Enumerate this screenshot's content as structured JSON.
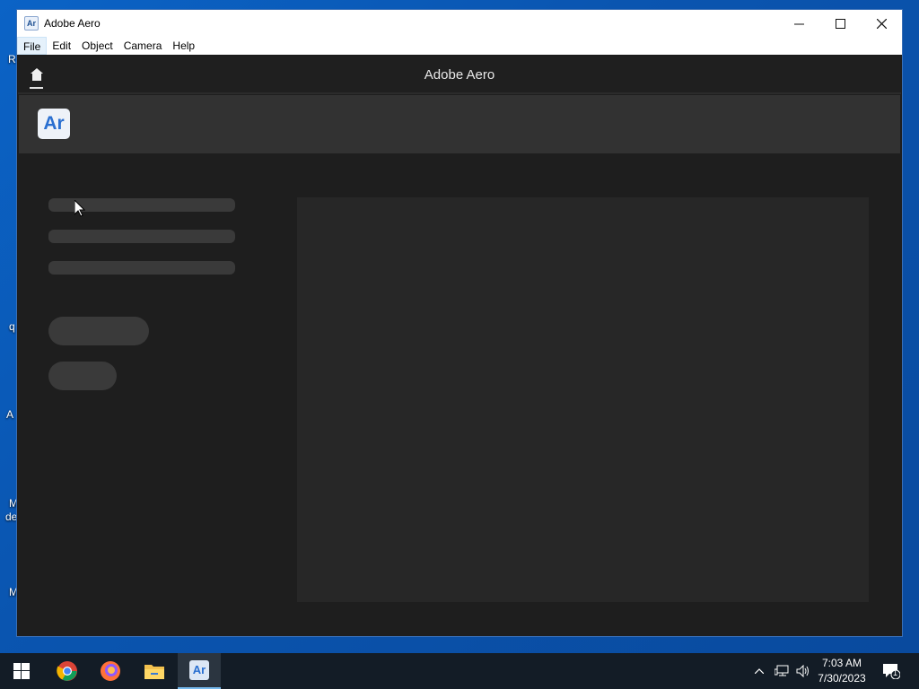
{
  "window": {
    "title": "Adobe Aero",
    "icon_label": "Ar",
    "controls": [
      "minimize-icon",
      "maximize-icon",
      "close-icon"
    ]
  },
  "menu": {
    "items": [
      "File",
      "Edit",
      "Object",
      "Camera",
      "Help"
    ]
  },
  "app_header": {
    "title": "Adobe Aero",
    "home_icon": "home-icon"
  },
  "banner": {
    "logo_text": "Ar"
  },
  "taskbar": {
    "apps": [
      "windows-start-icon",
      "chrome-icon",
      "firefox-icon",
      "file-explorer-icon",
      "adobe-aero-icon"
    ],
    "aero_label": "Ar",
    "clock_time": "7:03 AM",
    "clock_date": "7/30/2023",
    "notification_count": "1"
  },
  "desktop": {
    "label_fragments": [
      "R",
      "q",
      "A",
      "M",
      "de",
      "M"
    ]
  },
  "colors": {
    "app_background": "#1e1e1e",
    "banner": "#323232",
    "skeleton": "#3a3a3a",
    "accent_logo": "#2a6fd0",
    "taskbar": "#131c26"
  }
}
